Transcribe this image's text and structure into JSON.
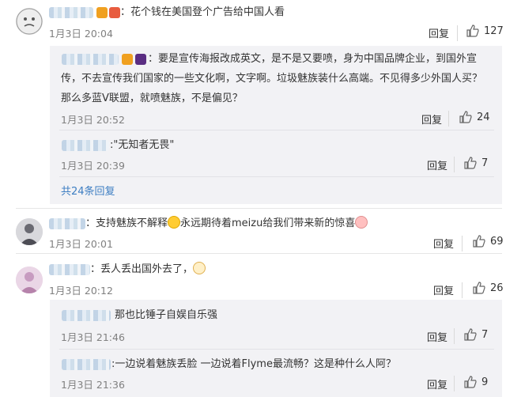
{
  "comments": [
    {
      "text": "：花个钱在美国登个广告给中国人看",
      "time": "1月3日 20:04",
      "reply_label": "回复",
      "likes": "127",
      "sub_replies": [
        {
          "text": "：要是宣传海报改成英文，是不是又要喷，身为中国品牌企业，到国外宣传，不去宣传我们国家的一些文化啊，文字啊。垃圾魅族装什么高端。不见得多少外国人买？那么多蓝V联盟，就喷魅族，不是偏见？",
          "line1": "：要是宣传海报改成英文，是不是又要喷，身为中国品牌企业，到国外宣",
          "line2": "传，不去宣传我们国家的一些文化啊，文字啊。垃圾魅族装什么高端。不见得多少外国人买？",
          "line3": "那么多蓝V联盟，就喷魅族，不是偏见？",
          "time": "1月3日 20:52",
          "reply_label": "回复",
          "likes": "24"
        },
        {
          "text": ":\"无知者无畏\"",
          "time": "1月3日 20:39",
          "reply_label": "回复",
          "likes": "7"
        }
      ],
      "more_label": "共24条回复"
    },
    {
      "text_a": "：支持魅族不解释",
      "text_b": "永远期待着meizu给我们带来新的惊喜",
      "time": "1月3日 20:01",
      "reply_label": "回复",
      "likes": "69"
    },
    {
      "text": "：丢人丢出国外去了，",
      "time": "1月3日 20:12",
      "reply_label": "回复",
      "likes": "26",
      "sub_replies": [
        {
          "text": "那也比锤子自娱自乐强",
          "time": "1月3日 21:46",
          "reply_label": "回复",
          "likes": "7"
        },
        {
          "text": ":一边说着魅族丢脸 一边说着Flyme最流畅？这是种什么人阿？",
          "time": "1月3日 21:36",
          "reply_label": "回复",
          "likes": "9"
        }
      ]
    }
  ],
  "colors": {
    "link": "#3d7ec2",
    "meta": "#808080",
    "subbox": "#f2f2f5"
  }
}
